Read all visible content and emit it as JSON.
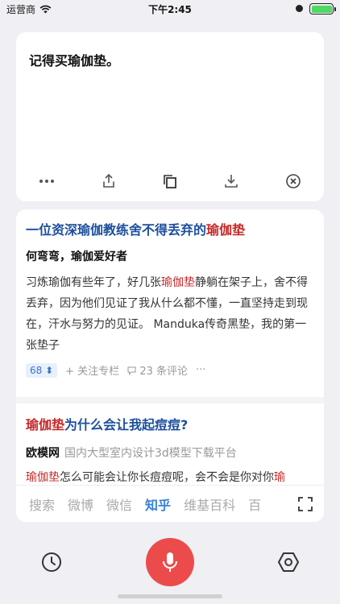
{
  "status_bar": {
    "carrier": "运营商",
    "time": "下午2:45"
  },
  "note": {
    "text": "记得买瑜伽垫。",
    "toolbar": [
      "more-icon",
      "share-icon",
      "copy-icon",
      "download-icon",
      "clear-icon"
    ]
  },
  "results": [
    {
      "title_prefix": "一位资深瑜伽教练舍不得丢弃的",
      "title_highlight": "瑜伽垫",
      "author": "何弯弯，瑜伽爱好者",
      "body_before": "习炼瑜伽有些年了，好几张",
      "body_highlight": "瑜伽垫",
      "body_after": "静躺在架子上，舍不得丢弃，因为他们见证了我从什么都不懂，一直坚持走到现在，汗水与努力的见证。 Manduka传奇黑垫，我的第一张垫子",
      "votes": "68",
      "follow": "+ 关注专栏",
      "comments": "23 条评论",
      "more": "···"
    },
    {
      "title_highlight": "瑜伽垫",
      "title_suffix": "为什么会让我起痘痘?",
      "site": "欧模网",
      "site_desc": "国内大型室内设计3d模型下载平台",
      "body_highlight": "瑜伽垫",
      "body_after": "怎么可能会让你长痘痘呢，会不会是你对你",
      "body_tail": "瑜"
    }
  ],
  "engines": [
    "搜索",
    "微博",
    "微信",
    "知乎",
    "维基百科",
    "百"
  ],
  "active_engine": "知乎",
  "colors": {
    "accent": "#3a80d9",
    "highlight": "#c62828",
    "title": "#1d4f9e",
    "mic": "#ec4b4b"
  }
}
